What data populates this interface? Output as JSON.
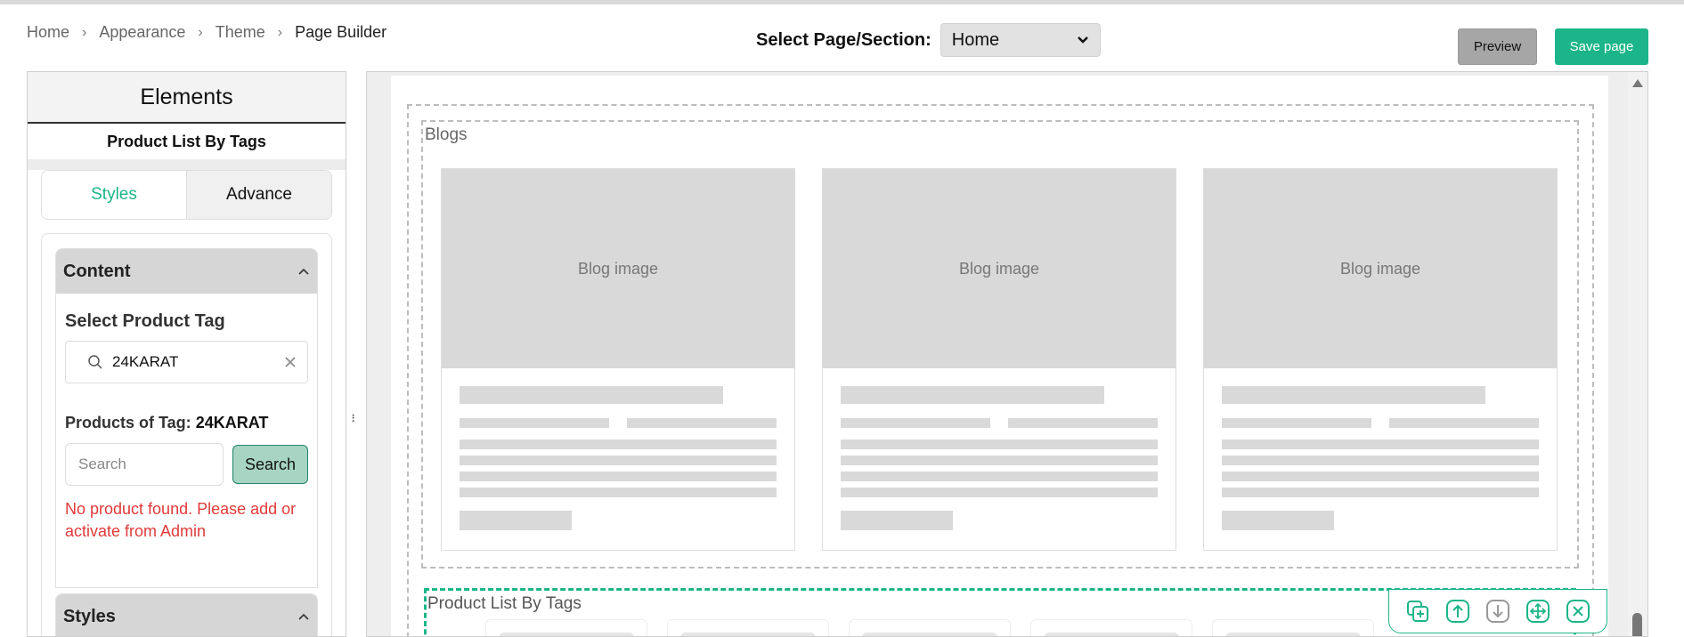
{
  "breadcrumb": {
    "items": [
      "Home",
      "Appearance",
      "Theme",
      "Page Builder"
    ]
  },
  "page_select": {
    "label": "Select Page/Section:",
    "value": "Home"
  },
  "actions": {
    "preview": "Preview",
    "save": "Save page"
  },
  "sidebar": {
    "title": "Elements",
    "subtitle": "Product List By Tags",
    "tabs": [
      "Styles",
      "Advance"
    ],
    "content_section": {
      "title": "Content",
      "select_tag_label": "Select Product Tag",
      "tag_value": "24KARAT",
      "products_label": "Products of Tag:",
      "products_tag": "24KARAT",
      "search_placeholder": "Search",
      "search_button": "Search",
      "error": "No product found. Please add or activate from Admin"
    },
    "styles_section": {
      "title": "Styles"
    }
  },
  "canvas": {
    "blogs_title": "Blogs",
    "blog_cards": [
      {
        "image_label": "Blog image"
      },
      {
        "image_label": "Blog image"
      },
      {
        "image_label": "Blog image"
      }
    ],
    "product_section_title": "Product List By Tags"
  },
  "colors": {
    "accent": "#1cb589",
    "error": "#e03a3a",
    "placeholder": "#d9d9d9"
  }
}
